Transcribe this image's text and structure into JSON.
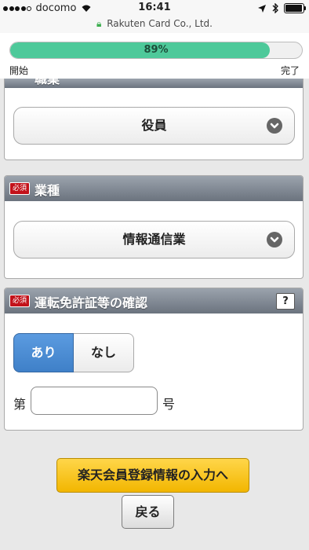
{
  "status_bar": {
    "carrier": "docomo",
    "time": "16:41",
    "signal_bars": 4,
    "battery_level": 1.0
  },
  "url_bar": {
    "site": "Rakuten Card Co., Ltd."
  },
  "progress": {
    "label": "89%",
    "value": 0.89,
    "start_label": "開始",
    "end_label": "完了"
  },
  "position_panel": {
    "title": "職業",
    "selected": "役員"
  },
  "industry_panel": {
    "badge": "必須",
    "title": "業種",
    "selected": "情報通信業"
  },
  "license_panel": {
    "badge": "必須",
    "title": "運転免許証等の確認",
    "help_label": "?",
    "options": [
      "あり",
      "なし"
    ],
    "selected_option": "あり",
    "number_prefix": "第",
    "number_value": "",
    "number_suffix": "号"
  },
  "actions": {
    "next_label": "楽天会員登録情報の入力へ",
    "back_label": "戻る"
  },
  "colors": {
    "progress_fill": "#4ec99a",
    "primary_button": "#f5be0b",
    "selected_option": "#4a8bd4",
    "required_badge": "#c2121a",
    "header": "#7d858f"
  }
}
